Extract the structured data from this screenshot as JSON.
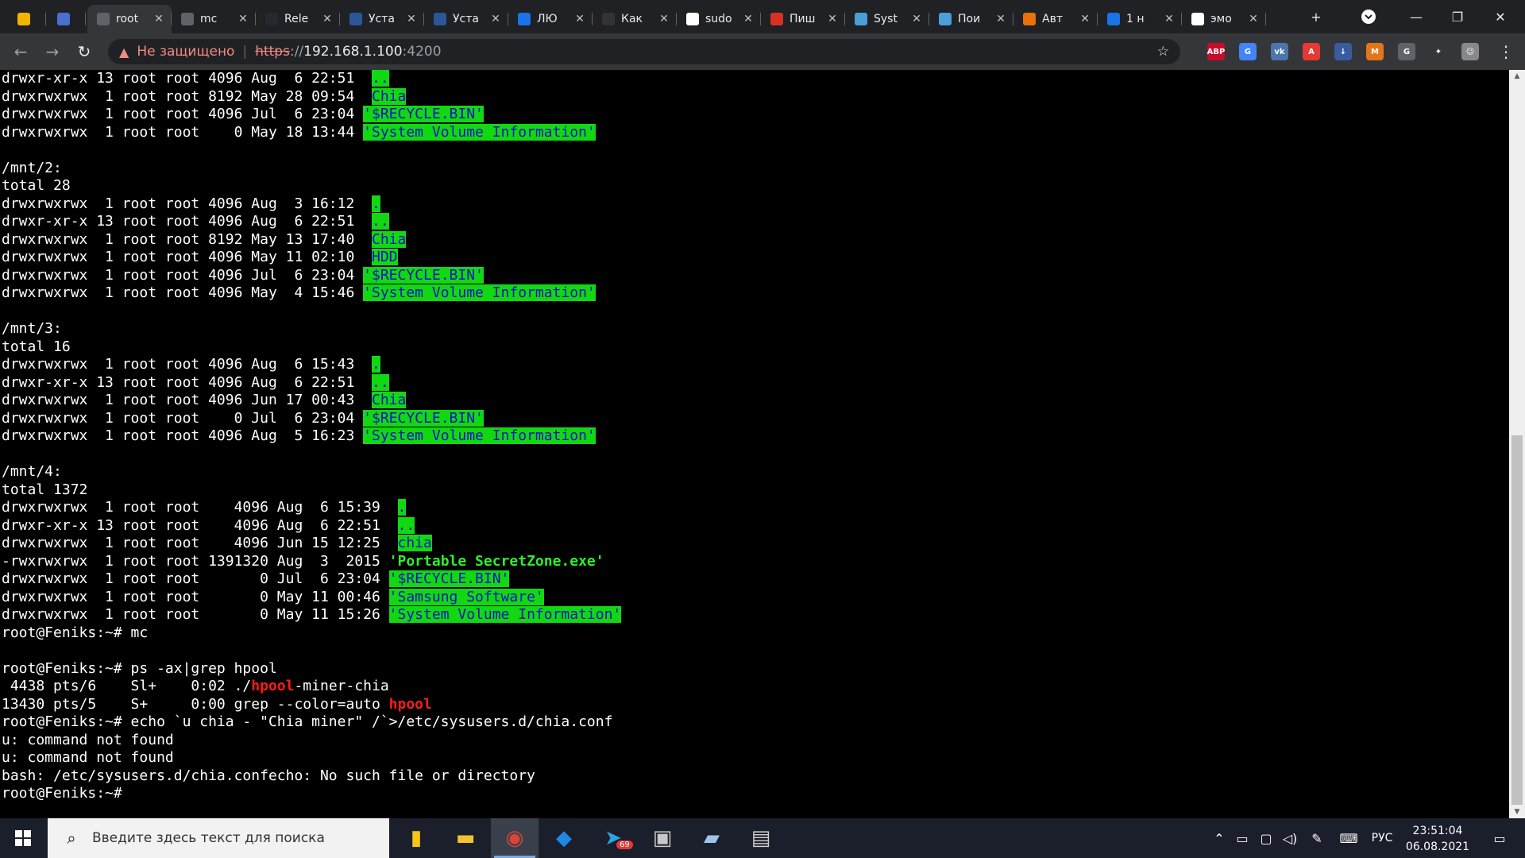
{
  "browser": {
    "tabs": [
      {
        "label": "",
        "icon": "spark-icon",
        "color": "#f4b400"
      },
      {
        "label": "",
        "icon": "doc-icon",
        "color": "#4a6fd1"
      },
      {
        "label": "root",
        "icon": "webmin-icon",
        "color": "#5f6368"
      },
      {
        "label": "mc",
        "icon": "webmin-icon",
        "color": "#5f6368"
      },
      {
        "label": "Rele",
        "icon": "github-icon",
        "color": "#24292e"
      },
      {
        "label": "Уста",
        "icon": "mc-icon",
        "color": "#2b579a"
      },
      {
        "label": "Уста",
        "icon": "mc-icon",
        "color": "#2b579a"
      },
      {
        "label": "ЛЮ",
        "icon": "pause-icon",
        "color": "#1a73e8"
      },
      {
        "label": "Как",
        "icon": "linux-icon",
        "color": "#333333"
      },
      {
        "label": "sudo",
        "icon": "google-icon",
        "color": "#ffffff"
      },
      {
        "label": "Пиш",
        "icon": "n-icon",
        "color": "#d93025"
      },
      {
        "label": "Syst",
        "icon": "gear-icon",
        "color": "#4a9fd8"
      },
      {
        "label": "Пои",
        "icon": "gear-icon",
        "color": "#4a9fd8"
      },
      {
        "label": "Авт",
        "icon": "b-icon",
        "color": "#e8710a"
      },
      {
        "label": "1 н",
        "icon": "one-icon",
        "color": "#1a73e8"
      },
      {
        "label": "эмо",
        "icon": "google-icon",
        "color": "#ffffff"
      }
    ],
    "new_tab": "+",
    "not_secure": "Не защищено",
    "url_scheme": "https",
    "url_sep": "://",
    "url_host": "192.168.1.100",
    "url_port": ":4200",
    "extensions": [
      {
        "label": "ABP",
        "color": "#c70d2c"
      },
      {
        "label": "G",
        "color": "#4285f4"
      },
      {
        "label": "vk",
        "color": "#4a76a8"
      },
      {
        "label": "A",
        "color": "#e53935"
      },
      {
        "label": "↓",
        "color": "#3a5ba0"
      },
      {
        "label": "M",
        "color": "#e2761b"
      },
      {
        "label": "G",
        "color": "#5f6368"
      },
      {
        "label": "✦",
        "color": "#35363a"
      },
      {
        "label": "☺",
        "color": "#888888"
      }
    ]
  },
  "terminal": {
    "lines": [
      [
        [
          "drwxr-xr-x 13 root root 4096 Aug  6 22:51  ",
          ""
        ],
        [
          "..",
          "dir"
        ]
      ],
      [
        [
          "drwxrwxrwx  1 root root 8192 May 28 09:54  ",
          ""
        ],
        [
          "Chia",
          "dir"
        ]
      ],
      [
        [
          "drwxrwxrwx  1 root root 4096 Jul  6 23:04 ",
          ""
        ],
        [
          "'$RECYCLE.BIN'",
          "dir"
        ]
      ],
      [
        [
          "drwxrwxrwx  1 root root    0 May 18 13:44 ",
          ""
        ],
        [
          "'System Volume Information'",
          "dir"
        ]
      ],
      [
        [
          "",
          ""
        ]
      ],
      [
        [
          "/mnt/2:",
          ""
        ]
      ],
      [
        [
          "total 28",
          ""
        ]
      ],
      [
        [
          "drwxrwxrwx  1 root root 4096 Aug  3 16:12  ",
          ""
        ],
        [
          ".",
          "dir"
        ]
      ],
      [
        [
          "drwxr-xr-x 13 root root 4096 Aug  6 22:51  ",
          ""
        ],
        [
          "..",
          "dir"
        ]
      ],
      [
        [
          "drwxrwxrwx  1 root root 8192 May 13 17:40  ",
          ""
        ],
        [
          "Chia",
          "dir"
        ]
      ],
      [
        [
          "drwxrwxrwx  1 root root 4096 May 11 02:10  ",
          ""
        ],
        [
          "HDD",
          "dir"
        ]
      ],
      [
        [
          "drwxrwxrwx  1 root root 4096 Jul  6 23:04 ",
          ""
        ],
        [
          "'$RECYCLE.BIN'",
          "dir"
        ]
      ],
      [
        [
          "drwxrwxrwx  1 root root 4096 May  4 15:46 ",
          ""
        ],
        [
          "'System Volume Information'",
          "dir"
        ]
      ],
      [
        [
          "",
          ""
        ]
      ],
      [
        [
          "/mnt/3:",
          ""
        ]
      ],
      [
        [
          "total 16",
          ""
        ]
      ],
      [
        [
          "drwxrwxrwx  1 root root 4096 Aug  6 15:43  ",
          ""
        ],
        [
          ".",
          "dir"
        ]
      ],
      [
        [
          "drwxr-xr-x 13 root root 4096 Aug  6 22:51  ",
          ""
        ],
        [
          "..",
          "dir"
        ]
      ],
      [
        [
          "drwxrwxrwx  1 root root 4096 Jun 17 00:43  ",
          ""
        ],
        [
          "Chia",
          "dir"
        ]
      ],
      [
        [
          "drwxrwxrwx  1 root root    0 Jul  6 23:04 ",
          ""
        ],
        [
          "'$RECYCLE.BIN'",
          "dir"
        ]
      ],
      [
        [
          "drwxrwxrwx  1 root root 4096 Aug  5 16:23 ",
          ""
        ],
        [
          "'System Volume Information'",
          "dir"
        ]
      ],
      [
        [
          "",
          ""
        ]
      ],
      [
        [
          "/mnt/4:",
          ""
        ]
      ],
      [
        [
          "total 1372",
          ""
        ]
      ],
      [
        [
          "drwxrwxrwx  1 root root    4096 Aug  6 15:39  ",
          ""
        ],
        [
          ".",
          "dir"
        ]
      ],
      [
        [
          "drwxr-xr-x 13 root root    4096 Aug  6 22:51  ",
          ""
        ],
        [
          "..",
          "dir"
        ]
      ],
      [
        [
          "drwxrwxrwx  1 root root    4096 Jun 15 12:25  ",
          ""
        ],
        [
          "chia",
          "dir"
        ]
      ],
      [
        [
          "-rwxrwxrwx  1 root root 1391320 Aug  3  2015 ",
          ""
        ],
        [
          "'Portable SecretZone.exe'",
          "exe"
        ]
      ],
      [
        [
          "drwxrwxrwx  1 root root       0 Jul  6 23:04 ",
          ""
        ],
        [
          "'$RECYCLE.BIN'",
          "dir"
        ]
      ],
      [
        [
          "drwxrwxrwx  1 root root       0 May 11 00:46 ",
          ""
        ],
        [
          "'Samsung Software'",
          "dir"
        ]
      ],
      [
        [
          "drwxrwxrwx  1 root root       0 May 11 15:26 ",
          ""
        ],
        [
          "'System Volume Information'",
          "dir"
        ]
      ],
      [
        [
          "root@Feniks:~# mc",
          ""
        ]
      ],
      [
        [
          "",
          ""
        ]
      ],
      [
        [
          "root@Feniks:~# ps -ax|grep hpool",
          ""
        ]
      ],
      [
        [
          " 4438 pts/6    Sl+    0:02 ./",
          ""
        ],
        [
          "hpool",
          "red"
        ],
        [
          "-miner-chia",
          ""
        ]
      ],
      [
        [
          "13430 pts/5    S+     0:00 grep --color=auto ",
          ""
        ],
        [
          "hpool",
          "red"
        ]
      ],
      [
        [
          "root@Feniks:~# echo `u chia - \"Chia miner\" /`>/etc/sysusers.d/chia.conf",
          ""
        ]
      ],
      [
        [
          "u: command not found",
          ""
        ]
      ],
      [
        [
          "u: command not found",
          ""
        ]
      ],
      [
        [
          "bash: /etc/sysusers.d/chia.confecho: No such file or directory",
          ""
        ]
      ],
      [
        [
          "root@Feniks:~# ",
          ""
        ]
      ]
    ]
  },
  "taskbar": {
    "search_placeholder": "Введите здесь текст для поиска",
    "apps": [
      {
        "name": "files-app-icon",
        "color": "#f5c518",
        "glyph": "▮",
        "active": false
      },
      {
        "name": "file-explorer-icon",
        "color": "#f2c230",
        "glyph": "▬",
        "active": false
      },
      {
        "name": "chrome-icon",
        "color": "#db4437",
        "glyph": "◉",
        "active": true
      },
      {
        "name": "diamond-app-icon",
        "color": "#1e88e5",
        "glyph": "◆",
        "active": false
      },
      {
        "name": "telegram-icon",
        "color": "#2aa3e0",
        "glyph": "➤",
        "active": false
      },
      {
        "name": "printer-icon",
        "color": "#c8c8c8",
        "glyph": "▣",
        "active": false
      },
      {
        "name": "notepad-icon",
        "color": "#9ec5e8",
        "glyph": "▰",
        "active": false
      },
      {
        "name": "archive-icon",
        "color": "#d0d0d0",
        "glyph": "▤",
        "active": false
      }
    ],
    "telegram_badge": "69",
    "lang": "РУС",
    "time": "23:51:04",
    "date": "06.08.2021"
  }
}
